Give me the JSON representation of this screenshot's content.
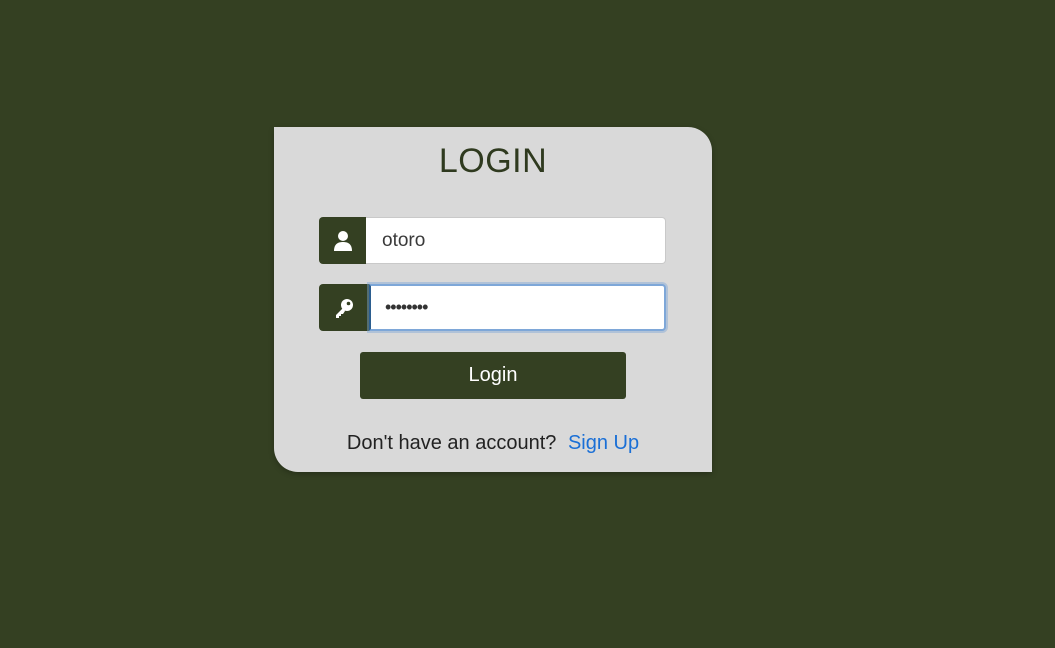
{
  "form": {
    "title": "LOGIN",
    "username": {
      "value": "otoro",
      "icon": "user-icon"
    },
    "password": {
      "value": "••••••••",
      "icon": "key-icon"
    },
    "login_label": "Login",
    "signup_prompt": "Don't have an account?",
    "signup_link": "Sign Up"
  },
  "colors": {
    "background": "#344022",
    "card": "#d9d9d9",
    "accent": "#344022",
    "link": "#1a6fd6"
  }
}
